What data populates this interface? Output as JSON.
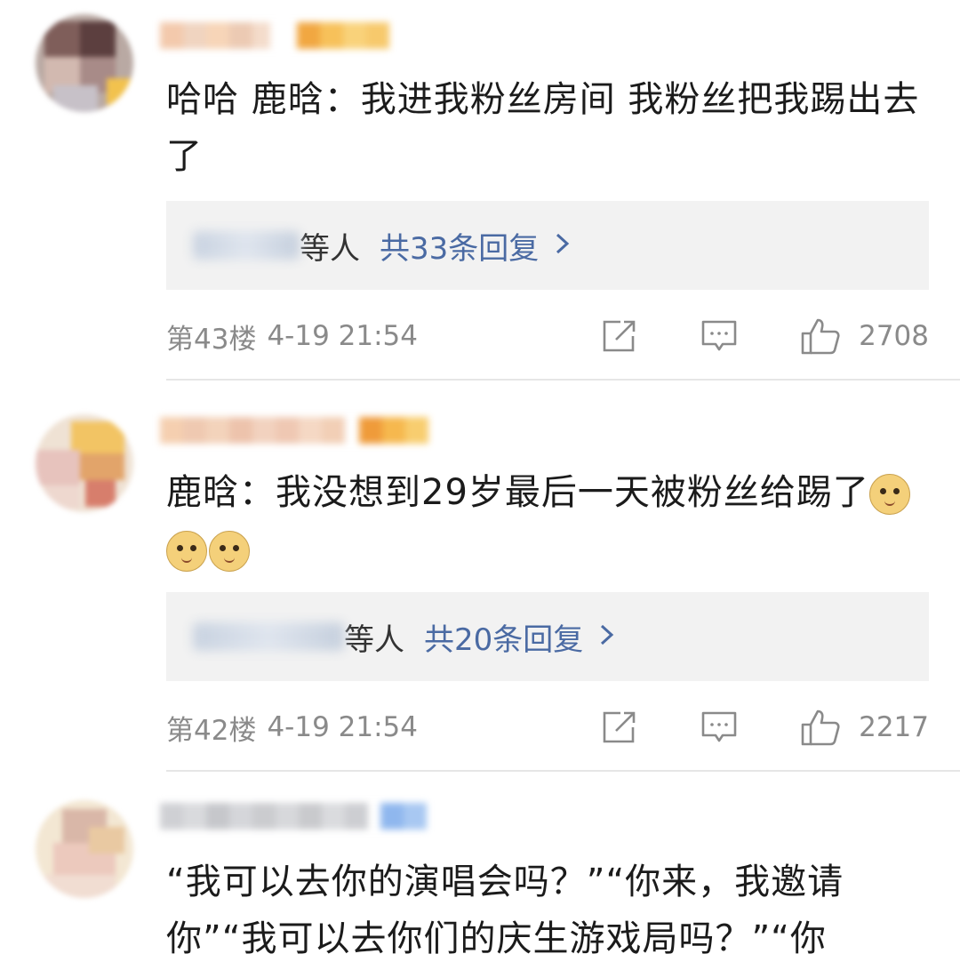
{
  "comments": [
    {
      "text": "哈哈 鹿晗：我进我粉丝房间 我粉丝把我踢出去了",
      "reply_who": "等人",
      "reply_count": "共33条回复",
      "floor": "第43楼",
      "time": "4-19 21:54",
      "likes": "2708"
    },
    {
      "text": "鹿晗：我没想到29岁最后一天被粉丝给踢了",
      "emoji": [
        "doge",
        "doge",
        "doge"
      ],
      "reply_who": "等人",
      "reply_count": "共20条回复",
      "floor": "第42楼",
      "time": "4-19 21:54",
      "likes": "2217"
    },
    {
      "text": "“我可以去你的演唱会吗？”“你来，我邀请你”“我可以去你们的庆生游戏局吗？”“你"
    }
  ],
  "icons": {
    "chevron": "chevron-right-icon",
    "share": "share-icon",
    "comment": "comment-icon",
    "like": "thumbs-up-icon"
  },
  "colors": {
    "link": "#4a6aa3",
    "meta": "#8a8a8a",
    "reply_bg": "#f2f2f2"
  }
}
